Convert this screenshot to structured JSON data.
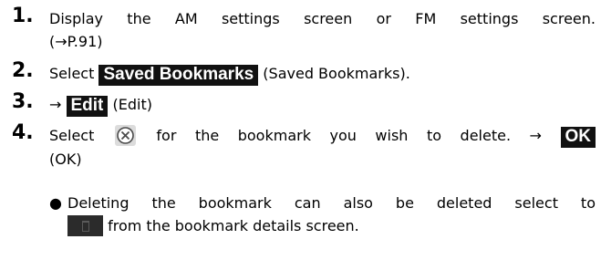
{
  "steps": [
    {
      "number": "1.",
      "line1": "Display the AM settings screen or FM settings screen.",
      "line2": "(→P.91)"
    },
    {
      "number": "2.",
      "prefix": "Select",
      "button": "Saved Bookmarks",
      "suffix": "(Saved Bookmarks)."
    },
    {
      "number": "3.",
      "arrow": "→",
      "button": "Edit",
      "suffix": "(Edit)"
    },
    {
      "number": "4.",
      "prefix": "Select",
      "icon": "circle-x-icon",
      "middle": "for the bookmark you wish to delete. →",
      "button": "OK",
      "line2": "(OK)"
    }
  ],
  "note": {
    "bullet": "●",
    "line1": "Deleting the bookmark can also be deleted select to",
    "icon": "trash-icon",
    "line2": "from the bookmark details screen."
  },
  "colors": {
    "button_bg": "#111111",
    "button_text": "#ffffff",
    "icon_bg": "#2b2b2b"
  }
}
